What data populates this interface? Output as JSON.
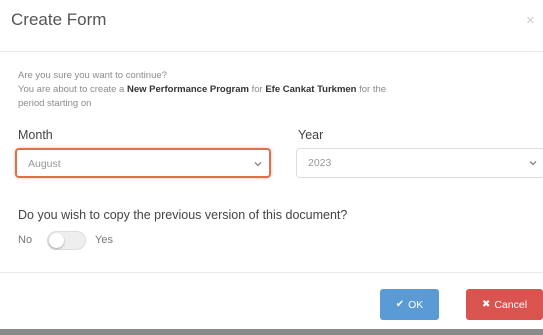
{
  "dialog": {
    "title": "Create Form",
    "close_icon": "close-icon"
  },
  "message": {
    "line1": "Are you sure you want to continue?",
    "line2_prefix": "You are about to create a ",
    "program_name": "New Performance Program",
    "line2_middle": " for ",
    "person_name": "Efe Cankat Turkmen",
    "line2_suffix": " for the",
    "line3": "period starting on"
  },
  "month": {
    "label": "Month",
    "selected": "August",
    "icon": "chevron-down-icon"
  },
  "year": {
    "label": "Year",
    "selected": "2023",
    "icon": "chevron-down-icon"
  },
  "copy_option": {
    "question": "Do you wish to copy the previous version of this document?",
    "no_label": "No",
    "yes_label": "Yes",
    "value": "No"
  },
  "footer": {
    "ok_label": "OK",
    "ok_icon": "check-icon",
    "cancel_label": "Cancel",
    "cancel_icon": "x-icon"
  },
  "colors": {
    "ok_button": "#5b9bd5",
    "cancel_button": "#d9534f",
    "focus_border": "#e0704b"
  }
}
